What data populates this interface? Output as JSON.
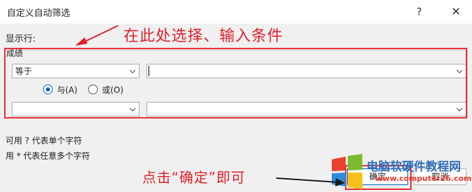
{
  "window": {
    "title": "自定义自动筛选",
    "help_label": "?",
    "close_label": "✕"
  },
  "show_rows_label": "显示行:",
  "annotation_top": "在此处选择、输入条件",
  "group": {
    "label": "成绩",
    "row1": {
      "operator_value": "等于",
      "value_text": ""
    },
    "radios": [
      {
        "label": "与(A)",
        "selected": true
      },
      {
        "label": "或(O)",
        "selected": false
      }
    ],
    "row2": {
      "operator_value": "",
      "value_text": ""
    }
  },
  "hints": [
    "可用 ? 代表单个字符",
    "用 * 代表任意多个字符"
  ],
  "annotation_bottom": "点击“确定”即可",
  "buttons": {
    "ok_label": "确定",
    "cancel_label": "取消"
  },
  "watermark": {
    "title": "电脑软硬件教程网",
    "url": "www.computer26.com"
  },
  "colors": {
    "annotation_red": "#e0202a",
    "radio_blue": "#1160c8",
    "ok_border": "#0067c0"
  }
}
